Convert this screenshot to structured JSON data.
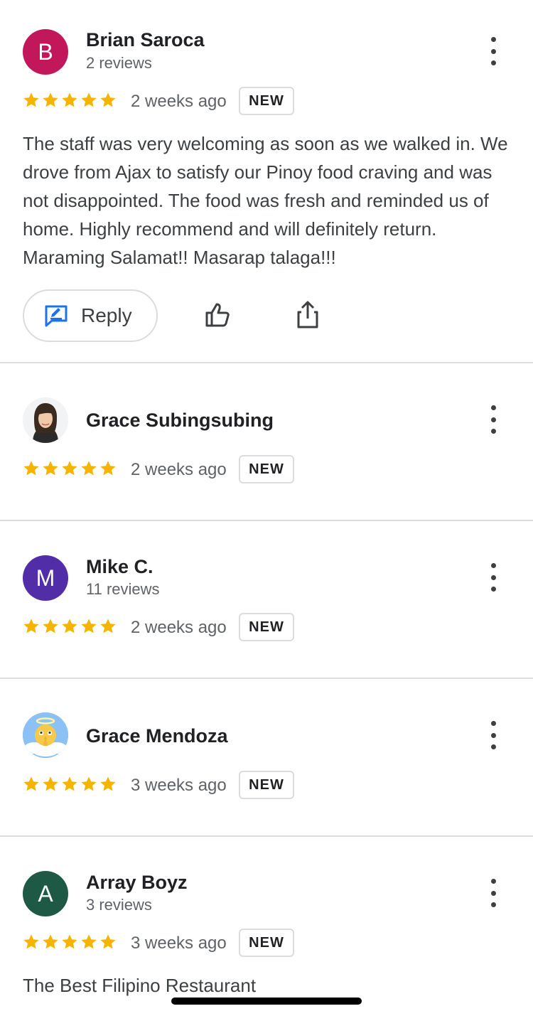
{
  "colors": {
    "star": "#f4b400",
    "text_primary": "#202124",
    "text_secondary": "#5f6368",
    "divider": "#dadce0",
    "reply_icon": "#1a73e8"
  },
  "reviews": [
    {
      "name": "Brian Saroca",
      "review_count": "2 reviews",
      "avatar_letter": "B",
      "avatar_color": "#c2185b",
      "stars": 5,
      "time": "2 weeks ago",
      "badge": "NEW",
      "text": "The staff was very welcoming as soon as we walked in. We drove from Ajax to satisfy our Pinoy food craving and was not disappointed. The food was fresh and reminded us of home. Highly recommend and will definitely return. Maraming Salamat!! Masarap talaga!!!",
      "reply_label": "Reply"
    },
    {
      "name": "Grace Subingsubing",
      "avatar_icon": "woman-photo-avatar",
      "stars": 5,
      "time": "2 weeks ago",
      "badge": "NEW"
    },
    {
      "name": "Mike C.",
      "review_count": "11 reviews",
      "avatar_letter": "M",
      "avatar_color": "#512da8",
      "stars": 5,
      "time": "2 weeks ago",
      "badge": "NEW"
    },
    {
      "name": "Grace Mendoza",
      "avatar_icon": "praying-angel-emoji-avatar",
      "stars": 5,
      "time": "3 weeks ago",
      "badge": "NEW"
    },
    {
      "name": "Array Boyz",
      "review_count": "3 reviews",
      "avatar_letter": "A",
      "avatar_color": "#1e5945",
      "stars": 5,
      "time": "3 weeks ago",
      "badge": "NEW",
      "text": "The Best Filipino Restaurant"
    }
  ]
}
